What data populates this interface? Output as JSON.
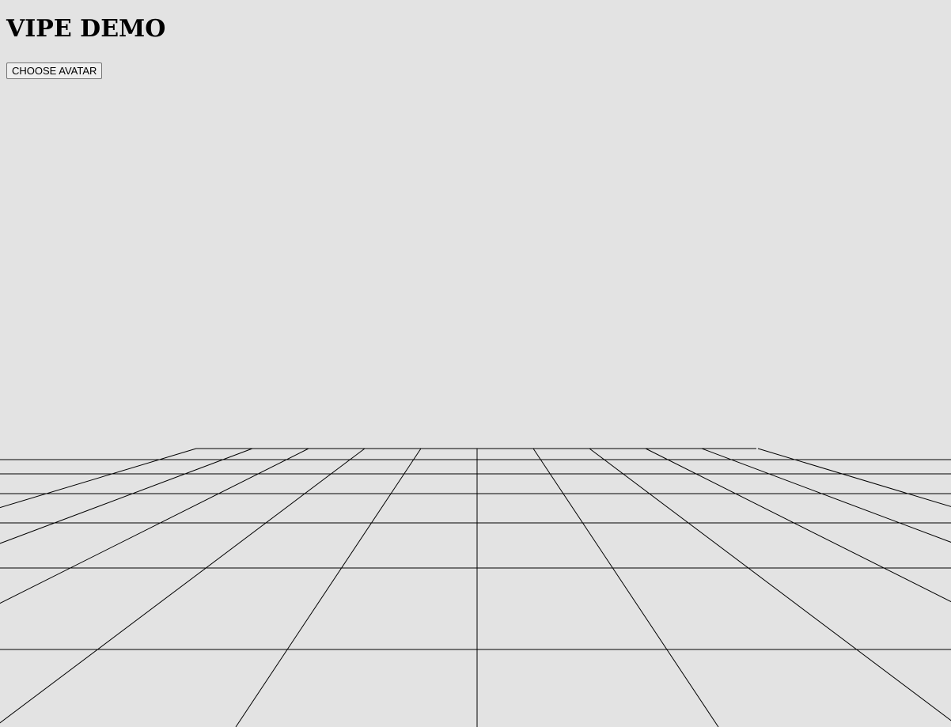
{
  "header": {
    "title": "VIPE DEMO"
  },
  "controls": {
    "choose_avatar_label": "CHOOSE AVATAR"
  },
  "scene": {
    "background_color": "#e3e3e3",
    "grid_line_color": "#000000",
    "grid_type": "perspective-floor"
  }
}
